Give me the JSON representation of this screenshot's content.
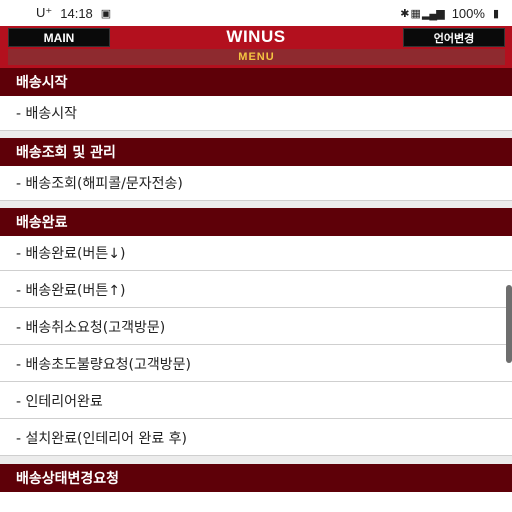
{
  "status_bar": {
    "carrier": "U⁺",
    "time": "14:18",
    "battery": "100%"
  },
  "header": {
    "main_button": "MAIN",
    "logo": "WINUS",
    "language_button": "언어변경",
    "menu_label": "MENU"
  },
  "sections": [
    {
      "title": "배송시작",
      "items": [
        "- 배송시작"
      ]
    },
    {
      "title": "배송조회 및 관리",
      "items": [
        "- 배송조회(해피콜/문자전송)"
      ]
    },
    {
      "title": "배송완료",
      "items": [
        "- 배송완료(버튼↓)",
        "- 배송완료(버튼↑)",
        "- 배송취소요청(고객방문)",
        "- 배송초도불량요청(고객방문)",
        "- 인테리어완료",
        "- 설치완료(인테리어 완료 후)"
      ]
    },
    {
      "title": "배송상태변경요청",
      "items": []
    }
  ]
}
